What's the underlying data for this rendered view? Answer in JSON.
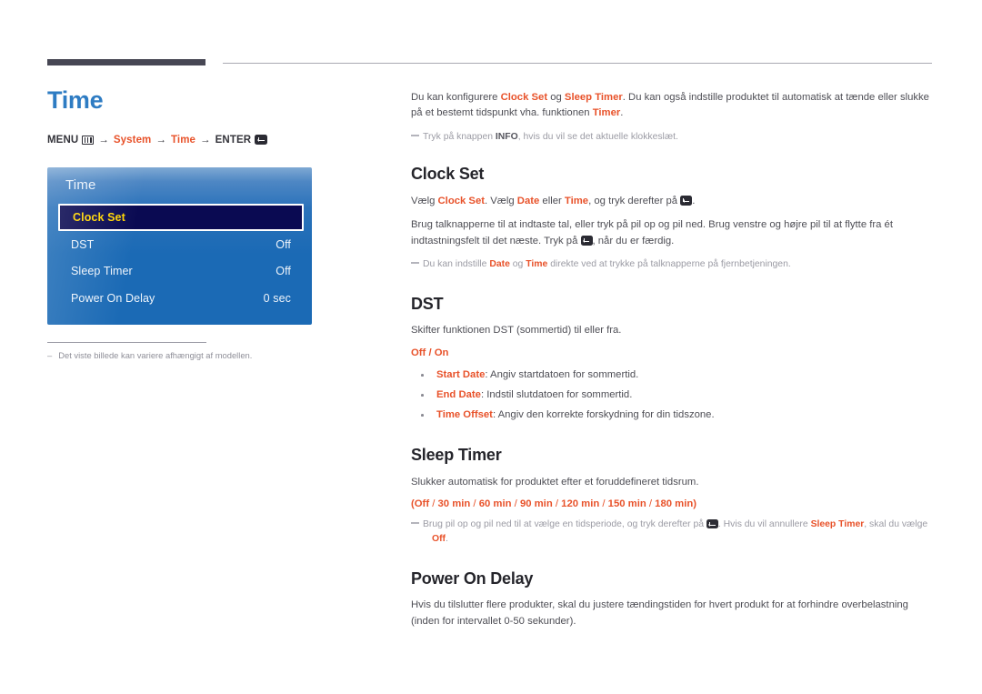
{
  "page": {
    "title": "Time",
    "breadcrumb": {
      "menu_label": "MENU",
      "menu_icon": "menu-grid-icon",
      "arrow": "→",
      "step1": "System",
      "step2": "Time",
      "enter_label": "ENTER",
      "enter_icon": "enter-key-icon"
    },
    "left_note": {
      "dash": "–",
      "text": "Det viste billede kan variere afhængigt af modellen."
    }
  },
  "osd": {
    "title": "Time",
    "rows": [
      {
        "label": "Clock Set",
        "value": "",
        "selected": true
      },
      {
        "label": "DST",
        "value": "Off",
        "selected": false
      },
      {
        "label": "Sleep Timer",
        "value": "Off",
        "selected": false
      },
      {
        "label": "Power On Delay",
        "value": "0 sec",
        "selected": false
      }
    ],
    "colors": {
      "highlight_bg": "#0a0a52",
      "highlight_text": "#ffd400",
      "panel_blue": "#1b6ab5",
      "text": "#eef4fb"
    }
  },
  "intro": {
    "p1_a": "Du kan konfigurere ",
    "p1_b": "Clock Set",
    "p1_c": " og ",
    "p1_d": "Sleep Timer",
    "p1_e": ". Du kan også indstille produktet til automatisk at tænde eller slukke på et bestemt tidspunkt vha. funktionen ",
    "p1_f": "Timer",
    "p1_g": ".",
    "note_a": "Tryk på knappen ",
    "note_b": "INFO",
    "note_c": ", hvis du vil se det aktuelle klokkeslæt."
  },
  "sections": {
    "clock_set": {
      "heading": "Clock Set",
      "p1_a": "Vælg ",
      "p1_b": "Clock Set",
      "p1_c": ". Vælg ",
      "p1_d": "Date",
      "p1_e": " eller ",
      "p1_f": "Time",
      "p1_g": ", og tryk derefter på ",
      "p1_h": ".",
      "p2_a": "Brug talknapperne til at indtaste tal, eller tryk på pil op og pil ned. Brug venstre og højre pil til at flytte fra ét indtastningsfelt til det næste. Tryk på ",
      "p2_b": ", når du er færdig.",
      "note_a": "Du kan indstille ",
      "note_b": "Date",
      "note_c": " og ",
      "note_d": "Time",
      "note_e": " direkte ved at trykke på talknapperne på fjernbetjeningen."
    },
    "dst": {
      "heading": "DST",
      "p1": "Skifter funktionen DST (sommertid) til eller fra.",
      "options": "Off / On",
      "bullets": [
        {
          "term": "Start Date",
          "desc": ": Angiv startdatoen for sommertid."
        },
        {
          "term": "End Date",
          "desc": ": Indstil slutdatoen for sommertid."
        },
        {
          "term": "Time Offset",
          "desc": ": Angiv den korrekte forskydning for din tidszone."
        }
      ]
    },
    "sleep_timer": {
      "heading": "Sleep Timer",
      "p1": "Slukker automatisk for produktet efter et foruddefineret tidsrum.",
      "options_open": "(",
      "options_list": [
        "Off",
        "30 min",
        "60 min",
        "90 min",
        "120 min",
        "150 min",
        "180 min"
      ],
      "options_close": ")",
      "note_a": "Brug pil op og pil ned til at vælge en tidsperiode, og tryk derefter på ",
      "note_b": ". Hvis du vil annullere ",
      "note_c": "Sleep Timer",
      "note_d": ", skal du vælge",
      "note_e": "Off",
      "note_f": "."
    },
    "power_on_delay": {
      "heading": "Power On Delay",
      "p1": "Hvis du tilslutter flere produkter, skal du justere tændingstiden for hvert produkt for at forhindre overbelastning (inden for intervallet 0-50 sekunder)."
    }
  },
  "theme": {
    "accent": "#e8522a",
    "title_blue": "#2e7cc3",
    "heading": "#25252b",
    "body": "#4e4e55",
    "note": "#9b9ba4",
    "rule_dark": "#474754"
  }
}
